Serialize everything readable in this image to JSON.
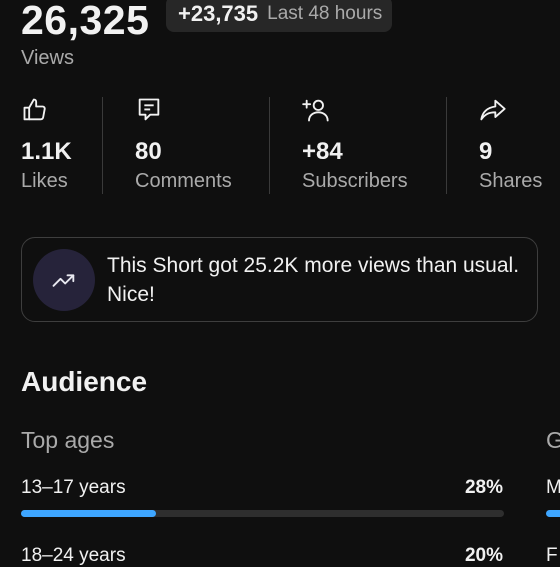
{
  "summary": {
    "views_count": "26,325",
    "views_delta": "+23,735",
    "period": "Last 48 hours",
    "views_label": "Views"
  },
  "stats": [
    {
      "icon": "thumbs-up-icon",
      "value": "1.1K",
      "label": "Likes"
    },
    {
      "icon": "comment-icon",
      "value": "80",
      "label": "Comments"
    },
    {
      "icon": "add-person-icon",
      "value": "+84",
      "label": "Subscribers"
    },
    {
      "icon": "share-icon",
      "value": "9",
      "label": "Shares"
    }
  ],
  "insight": {
    "icon": "trending-up-icon",
    "text": "This Short got 25.2K more views than usual. Nice!"
  },
  "audience": {
    "title": "Audience",
    "top_ages_label": "Top ages",
    "gender_label_partial": "G",
    "ages": [
      {
        "label": "13–17 years",
        "percent_text": "28%",
        "fraction": 0.28
      },
      {
        "label": "18–24 years",
        "percent_text": "20%",
        "fraction": 0.2
      }
    ],
    "gender_rows": [
      {
        "label_partial": "M"
      },
      {
        "label_partial": "F"
      }
    ]
  },
  "colors": {
    "background": "#0f0f0f",
    "accent_bar": "#3ea6ff",
    "muted_text": "#aaaaaa",
    "insight_icon_bg": "#26233a"
  }
}
